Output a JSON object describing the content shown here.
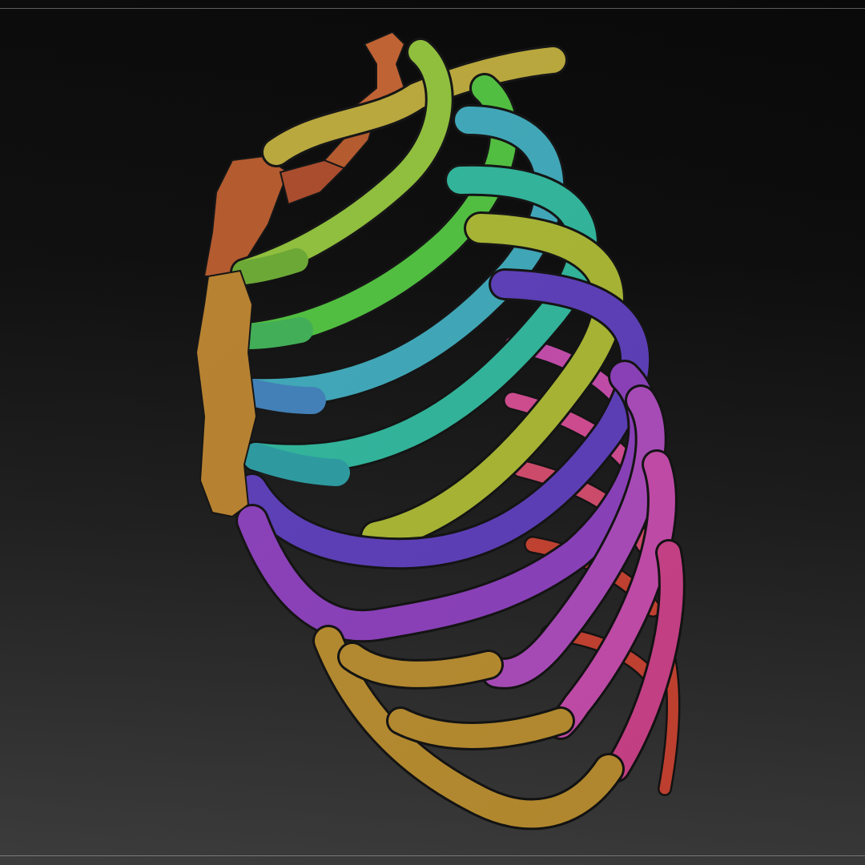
{
  "scene": {
    "background_top": "#050505",
    "background_bottom": "#3a3a3a",
    "frame_line": "#6a6a6a"
  },
  "model": {
    "subject": "ribcage-icon",
    "colors": {
      "scapula": "#b4582c",
      "scapula_dark": "#a94a2a",
      "manubrium": "#b85d32",
      "sternum": "#b7812e",
      "clavicle": "#b9a73a",
      "rib1": "#8fbf3a",
      "rib2": "#4fbf3e",
      "rib3": "#3ea7b8",
      "rib4": "#2fb49a",
      "rib5": "#a7b432",
      "rib6": "#5b3db7",
      "rib7": "#8a3fb9",
      "rib8": "#c14aa8",
      "rib9": "#c73f86",
      "rib10": "#c23a4a",
      "costal_arch": "#b58a2e",
      "back_rib": "#cf4a6b",
      "back_rib_red": "#c2402f"
    }
  }
}
